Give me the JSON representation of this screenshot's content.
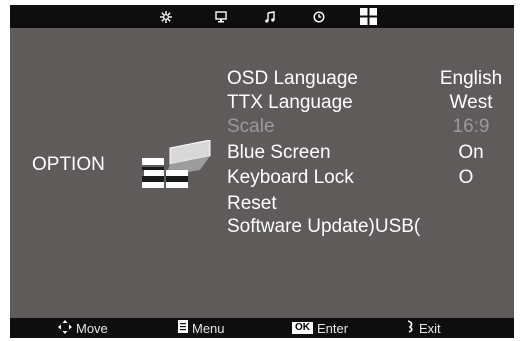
{
  "top_icons": [
    {
      "name": "picture-icon",
      "active": false
    },
    {
      "name": "screen-icon",
      "active": false
    },
    {
      "name": "music-note-icon",
      "active": false
    },
    {
      "name": "clock-icon",
      "active": false
    },
    {
      "name": "option-grid-icon",
      "active": true
    }
  ],
  "section_title": "OPTION",
  "menu": [
    {
      "label": "OSD Language",
      "value": "English",
      "disabled": false
    },
    {
      "label": "TTX Language",
      "value": "West",
      "disabled": false
    },
    {
      "label": "Scale",
      "value": "16:9",
      "disabled": true
    },
    {
      "label": "Blue Screen",
      "value": "On",
      "disabled": false
    },
    {
      "label": "Keyboard Lock",
      "value": "O",
      "disabled": false
    },
    {
      "label": "Reset",
      "value": "",
      "disabled": false
    },
    {
      "label": "Software Update)USB(",
      "value": "",
      "disabled": false
    }
  ],
  "footer": {
    "move": "Move",
    "menu": "Menu",
    "ok_badge": "OK",
    "enter": "Enter",
    "exit": "Exit"
  },
  "colors": {
    "panel": "#5e5b5a",
    "bar": "#0e0e0e",
    "text": "#ffffff",
    "disabled_text": "#9a9898"
  }
}
